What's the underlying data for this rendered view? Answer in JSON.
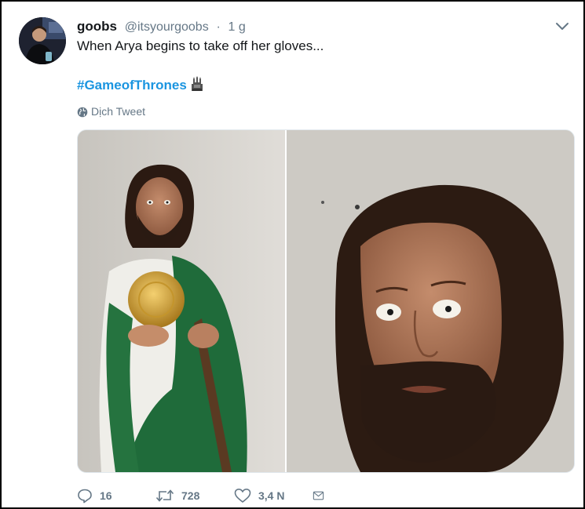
{
  "tweet": {
    "display_name": "goobs",
    "handle": "@itsyourgoobs",
    "separator": "·",
    "time": "1 g",
    "text": "When Arya begins to take off her gloves...",
    "hashtag": "#GameofThrones",
    "hashtag_emoji": "iron-throne-icon",
    "translate_label": "Dịch Tweet"
  },
  "actions": {
    "reply_count": "16",
    "retweet_count": "728",
    "like_count": "3,4 N"
  },
  "icons": {
    "menu": "chevron-down-icon",
    "translate": "globe-icon",
    "reply": "reply-icon",
    "retweet": "retweet-icon",
    "like": "heart-icon",
    "dm": "envelope-icon"
  },
  "colors": {
    "hashtag": "#1b95e0",
    "secondary_text": "#657786",
    "primary_text": "#14171a",
    "border": "#e1e8ed"
  }
}
